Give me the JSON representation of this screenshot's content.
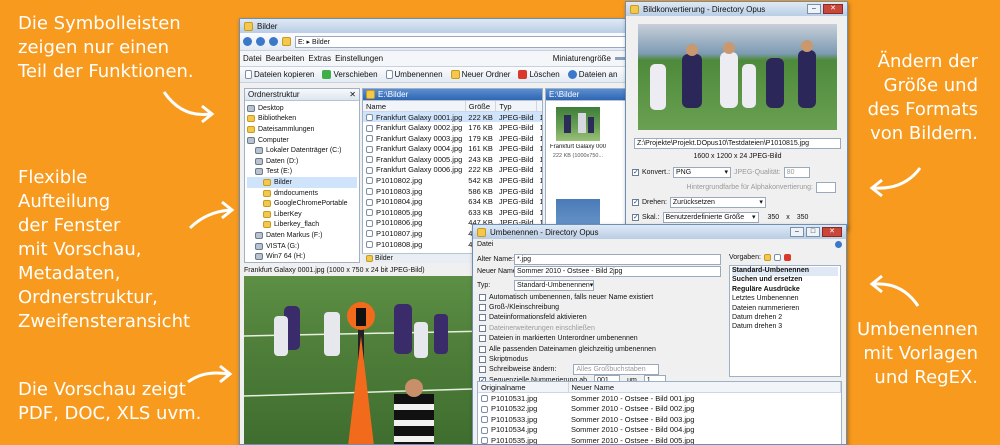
{
  "colors": {
    "background": "#f79a1e",
    "callout_text": "#ffffff"
  },
  "callouts": {
    "toolbars": [
      "Die Symbolleisten",
      "zeigen nur einen",
      "Teil der Funktionen."
    ],
    "layout": [
      "Flexible",
      "Aufteilung",
      "der Fenster",
      "mit Vorschau,",
      "Metadaten,",
      "Ordnerstruktur,",
      "Zweifensteransicht"
    ],
    "preview": [
      "Die Vorschau zeigt",
      "PDF, DOC, XLS uvm."
    ],
    "convert": [
      "Ändern der",
      "Größe und",
      "des Formats",
      "von Bildern."
    ],
    "rename": [
      "Umbenennen",
      "mit Vorlagen",
      "und RegEX."
    ]
  },
  "explorer": {
    "title": "Bilder",
    "path": "E: ▸ Bilder",
    "menu": [
      "Datei",
      "Bearbeiten",
      "Extras",
      "Einstellungen"
    ],
    "thumbsize_label": "Miniaturengröße",
    "toolbar": [
      "Dateien kopieren",
      "Verschieben",
      "Umbenennen",
      "Neuer Ordner",
      "Löschen",
      "Dateien an"
    ],
    "tree_header": "Ordnerstruktur",
    "tree": [
      {
        "label": "Desktop",
        "icon": "desktop-icon"
      },
      {
        "label": "Bibliotheken",
        "icon": "folder-icon"
      },
      {
        "label": "Dateisammlungen",
        "icon": "folder-icon"
      },
      {
        "label": "Computer",
        "icon": "computer-icon"
      },
      {
        "label": "Lokaler Datenträger (C:)",
        "icon": "drive-icon"
      },
      {
        "label": "Daten (D:)",
        "icon": "drive-icon"
      },
      {
        "label": "Test (E:)",
        "icon": "drive-icon"
      },
      {
        "label": "Bilder",
        "icon": "folder-icon",
        "selected": true
      },
      {
        "label": "dmdocuments",
        "icon": "folder-icon"
      },
      {
        "label": "GoogleChromePortable",
        "icon": "folder-icon"
      },
      {
        "label": "LiberKey",
        "icon": "folder-icon"
      },
      {
        "label": "Liberkey_flach",
        "icon": "folder-icon"
      },
      {
        "label": "Daten Markus (F:)",
        "icon": "drive-icon"
      },
      {
        "label": "VISTA (G:)",
        "icon": "drive-icon"
      },
      {
        "label": "Win7 64 (H:)",
        "icon": "drive-icon"
      },
      {
        "label": "FTP",
        "icon": "globe-icon"
      }
    ],
    "file_pane_path": "E:\\Bilder",
    "columns": [
      "Name",
      "Größe",
      "Typ"
    ],
    "files": [
      {
        "name": "Frankfurt Galaxy 0001.jpg",
        "size": "222 KB",
        "type": "JPEG-Bild",
        "extra": "12.0"
      },
      {
        "name": "Frankfurt Galaxy 0002.jpg",
        "size": "176 KB",
        "type": "JPEG-Bild",
        "extra": "12.0"
      },
      {
        "name": "Frankfurt Galaxy 0003.jpg",
        "size": "179 KB",
        "type": "JPEG-Bild",
        "extra": "12.0"
      },
      {
        "name": "Frankfurt Galaxy 0004.jpg",
        "size": "161 KB",
        "type": "JPEG-Bild",
        "extra": "12.0"
      },
      {
        "name": "Frankfurt Galaxy 0005.jpg",
        "size": "243 KB",
        "type": "JPEG-Bild",
        "extra": "12.0"
      },
      {
        "name": "Frankfurt Galaxy 0006.jpg",
        "size": "222 KB",
        "type": "JPEG-Bild",
        "extra": "12.0"
      },
      {
        "name": "P1010802.jpg",
        "size": "542 KB",
        "type": "JPEG-Bild",
        "extra": "16.0"
      },
      {
        "name": "P1010803.jpg",
        "size": "586 KB",
        "type": "JPEG-Bild",
        "extra": "16.0"
      },
      {
        "name": "P1010804.jpg",
        "size": "634 KB",
        "type": "JPEG-Bild",
        "extra": "16.0"
      },
      {
        "name": "P1010805.jpg",
        "size": "633 KB",
        "type": "JPEG-Bild",
        "extra": "16.0"
      },
      {
        "name": "P1010806.jpg",
        "size": "447 KB",
        "type": "JPEG-Bild",
        "extra": "16.0"
      },
      {
        "name": "P1010807.jpg",
        "size": "490 KB",
        "type": "JPEG-Bild",
        "extra": "16.0"
      },
      {
        "name": "P1010808.jpg",
        "size": "435 KB",
        "type": "JPEG-Bild",
        "extra": "16.0"
      }
    ],
    "tab_label": "Bilder",
    "thumb_pane_path": "E:\\Bilder",
    "thumb_caption": "Frankfurt Galaxy 0001.jpg",
    "thumb_meta": "222 KB (1000x750...",
    "preview_status": "Frankfurt Galaxy 0001.jpg (1000 x 750 x 24 bit JPEG-Bild)"
  },
  "convert": {
    "title": "Bildkonvertierung - Directory Opus",
    "path": "Z:\\Projekte\\Projekt.DOpus10\\Testdateien\\P1010815.jpg",
    "info": "1600 x 1200 x 24 JPEG-Bild",
    "convert_label": "Konvert.:",
    "format": "PNG",
    "quality_label": "JPEG-Qualität:",
    "quality_value": "80",
    "alpha_label": "Hintergrundfarbe für Alphakonvertierung:",
    "rotate_label": "Drehen:",
    "rotate_value": "Zurücksetzen",
    "scale_label": "Skal.:",
    "scale_mode": "Benutzerdefinierte Größe",
    "width": "350",
    "x": "x",
    "height": "350"
  },
  "rename": {
    "title": "Umbenennen - Directory Opus",
    "menu": "Datei",
    "old_label": "Alter Name:",
    "old_value": "*.jpg",
    "new_label": "Neuer Name:",
    "new_value": "Sommer 2010 - Ostsee - Bild 2jpg",
    "type_label": "Typ:",
    "type_value": "Standard-Umbenennen",
    "presets_label": "Vorgaben:",
    "options": [
      {
        "label": "Automatisch umbenennen, falls neuer Name existiert",
        "checked": false,
        "disabled": false
      },
      {
        "label": "Groß-/Kleinschreibung",
        "checked": false,
        "disabled": false
      },
      {
        "label": "Dateiinformationsfeld aktivieren",
        "checked": false,
        "disabled": false
      },
      {
        "label": "Dateinerweiterungen einschließen",
        "checked": false,
        "disabled": true
      },
      {
        "label": "Dateien in markierten Unterordner umbenennen",
        "checked": false,
        "disabled": false
      },
      {
        "label": "Alle passenden Dateinamen gleichzeitig umbenennen",
        "checked": false,
        "disabled": false
      },
      {
        "label": "Skriptmodus",
        "checked": false,
        "disabled": false
      },
      {
        "label": "Schreibweise ändern:",
        "checked": false,
        "disabled": false
      },
      {
        "label": "Sequenzielle Nummerierung ab",
        "checked": true,
        "disabled": false
      }
    ],
    "case_value": "Alles Großbuchstaben",
    "seq_start": "001",
    "seq_um": "um",
    "seq_step": "1",
    "presets": [
      {
        "label": "Standard-Umbenennen",
        "bold": true
      },
      {
        "label": "Suchen und ersetzen",
        "bold": true
      },
      {
        "label": "Reguläre Ausdrücke",
        "bold": true
      },
      {
        "label": "Letztes Umbenennen",
        "bold": false
      },
      {
        "label": "Dateien nummerieren",
        "bold": false
      },
      {
        "label": "Datum drehen 2",
        "bold": false
      },
      {
        "label": "Datum drehen 3",
        "bold": false
      }
    ],
    "col_orig": "Originalname",
    "col_new": "Neuer Name",
    "rows": [
      {
        "orig": "P1010531.jpg",
        "new": "Sommer 2010 - Ostsee - Bild 001.jpg"
      },
      {
        "orig": "P1010532.jpg",
        "new": "Sommer 2010 - Ostsee - Bild 002.jpg"
      },
      {
        "orig": "P1010533.jpg",
        "new": "Sommer 2010 - Ostsee - Bild 003.jpg"
      },
      {
        "orig": "P1010534.jpg",
        "new": "Sommer 2010 - Ostsee - Bild 004.jpg"
      },
      {
        "orig": "P1010535.jpg",
        "new": "Sommer 2010 - Ostsee - Bild 005.jpg"
      },
      {
        "orig": "P1010536.jpg",
        "new": "Sommer 2010 - Ostsee - Bild 006.jpg"
      }
    ]
  }
}
